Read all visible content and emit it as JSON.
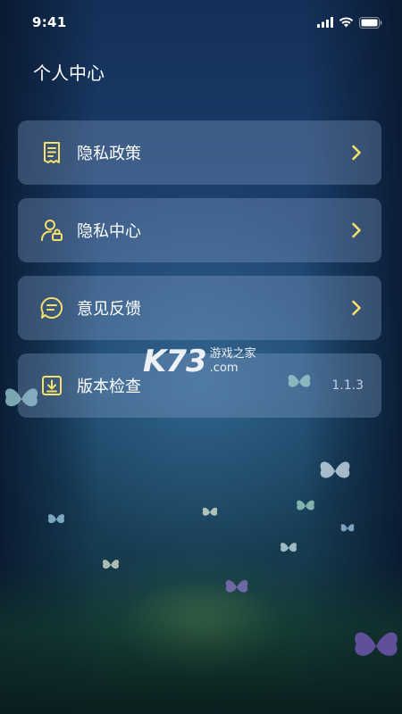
{
  "status_bar": {
    "time": "9:41"
  },
  "header": {
    "title": "个人中心"
  },
  "menu": [
    {
      "label": "隐私政策",
      "icon": "document-icon",
      "trailing": "chevron"
    },
    {
      "label": "隐私中心",
      "icon": "user-lock-icon",
      "trailing": "chevron"
    },
    {
      "label": "意见反馈",
      "icon": "chat-bubble-icon",
      "trailing": "chevron"
    },
    {
      "label": "版本检查",
      "icon": "download-box-icon",
      "trailing": "value",
      "value": "1.1.3"
    }
  ],
  "watermark": {
    "logo": "K73",
    "text_cn": "游戏之家",
    "text_domain": ".com"
  },
  "colors": {
    "accent": "#f4e06a",
    "card_bg": "rgba(150,175,215,0.30)",
    "text": "#ffffff"
  }
}
